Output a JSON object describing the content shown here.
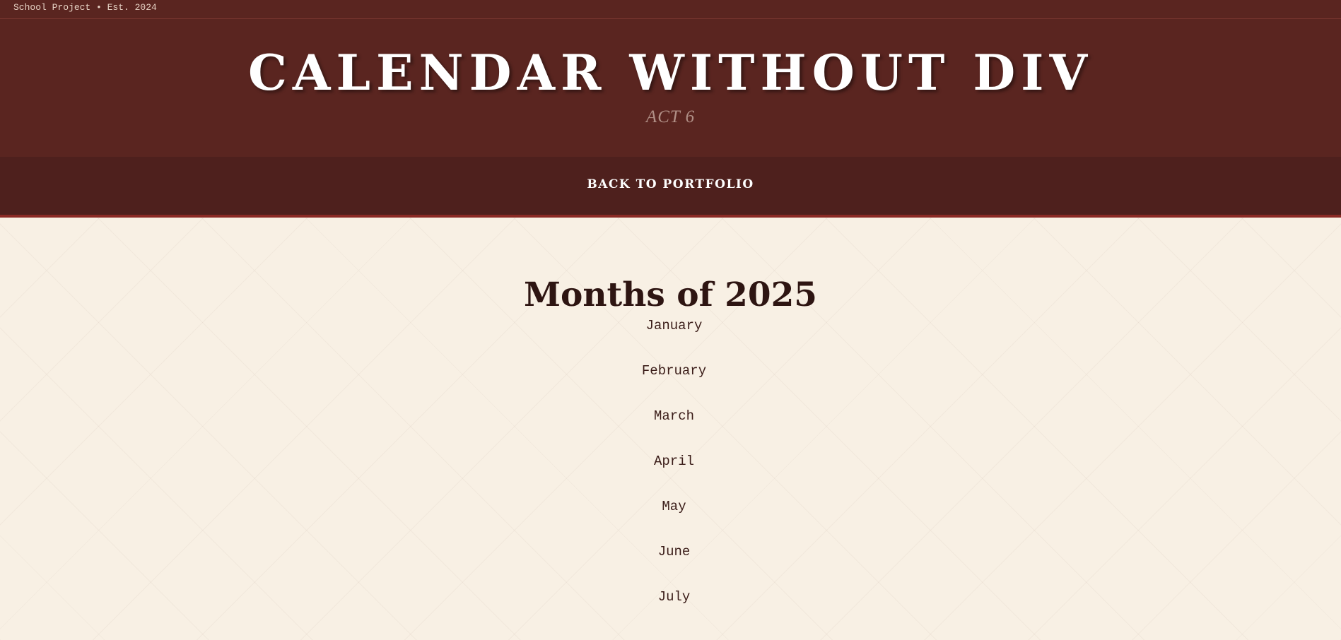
{
  "topbar": {
    "text": "School Project • Est. 2024"
  },
  "hero": {
    "title": "CALENDAR WITHOUT DIV",
    "subtitle": "ACT 6"
  },
  "nav": {
    "back_label": "BACK TO PORTFOLIO"
  },
  "main": {
    "heading": "Months of 2025",
    "months": [
      "January",
      "February",
      "March",
      "April",
      "May",
      "June",
      "July"
    ]
  },
  "colors": {
    "header_bg": "#5a2520",
    "nav_bg": "#4e201d",
    "accent_border": "#8a2a25",
    "page_bg": "#f8f0e4",
    "heading_text": "#2e1512"
  }
}
